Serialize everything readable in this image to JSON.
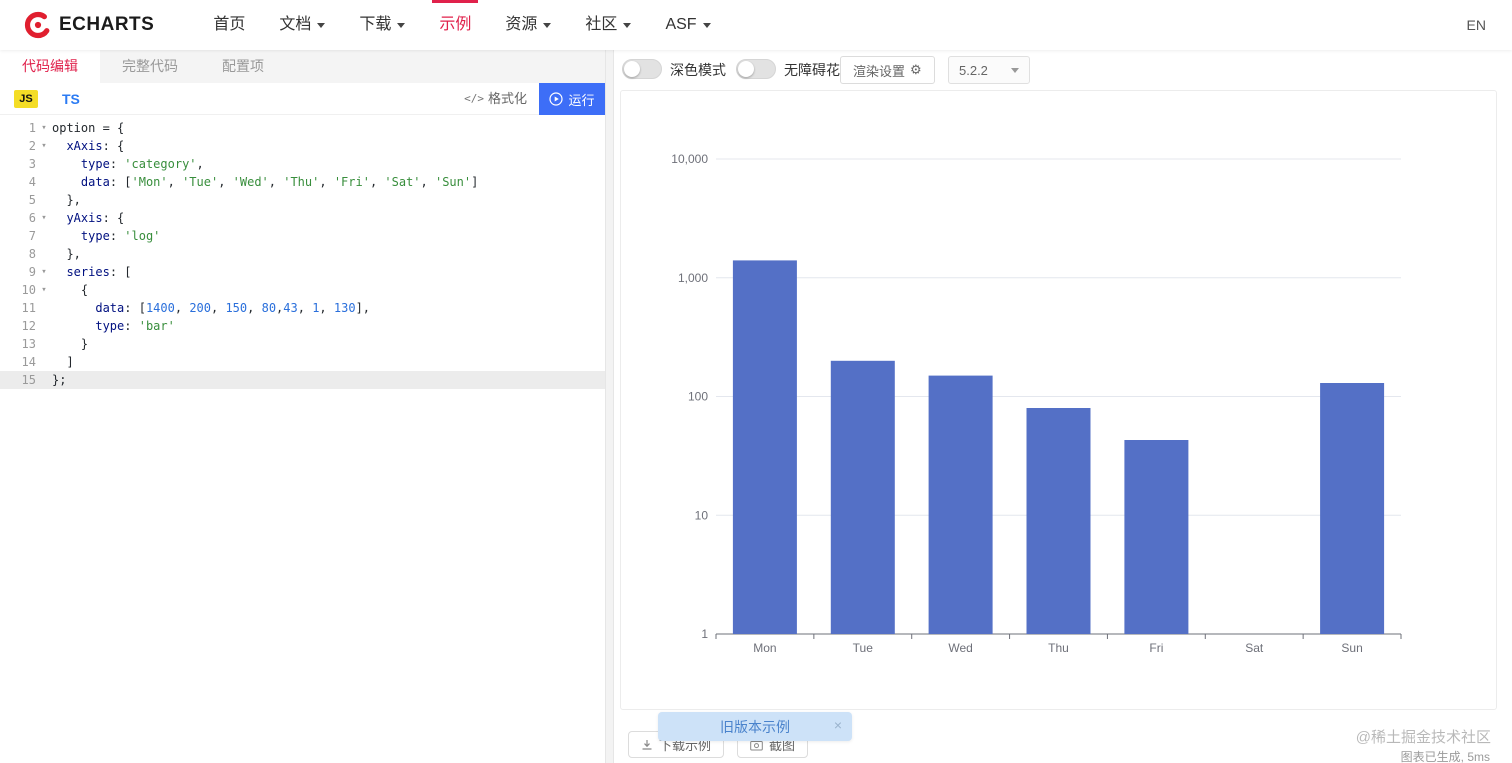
{
  "colors": {
    "accent": "#e0214b",
    "logo_red": "#e01f2f",
    "run_button": "#3d6ef7",
    "ts_blue": "#2b7bf3",
    "js_badge": "#f4dd26"
  },
  "nav": {
    "logo_text": "ECHARTS",
    "lang": "EN",
    "items": [
      {
        "label": "首页"
      },
      {
        "label": "文档"
      },
      {
        "label": "下载"
      },
      {
        "label": "示例"
      },
      {
        "label": "资源"
      },
      {
        "label": "社区"
      },
      {
        "label": "ASF"
      }
    ]
  },
  "editor": {
    "tabs": [
      {
        "label": "代码编辑"
      },
      {
        "label": "完整代码"
      },
      {
        "label": "配置项"
      }
    ],
    "js_label": "JS",
    "ts_label": "TS",
    "format_icon": "</>",
    "format_label": "格式化",
    "run_label": "运行",
    "lines": [
      {
        "num": 1,
        "fold": true,
        "cur": false,
        "segs": [
          [
            "p",
            "option = {"
          ]
        ]
      },
      {
        "num": 2,
        "fold": true,
        "cur": false,
        "segs": [
          [
            "p",
            "  "
          ],
          [
            "k",
            "xAxis"
          ],
          [
            "p",
            ": {"
          ]
        ]
      },
      {
        "num": 3,
        "fold": false,
        "cur": false,
        "segs": [
          [
            "p",
            "    "
          ],
          [
            "k",
            "type"
          ],
          [
            "p",
            ": "
          ],
          [
            "s",
            "'category'"
          ],
          [
            "p",
            ","
          ]
        ]
      },
      {
        "num": 4,
        "fold": false,
        "cur": false,
        "segs": [
          [
            "p",
            "    "
          ],
          [
            "k",
            "data"
          ],
          [
            "p",
            ": ["
          ],
          [
            "s",
            "'Mon'"
          ],
          [
            "p",
            ", "
          ],
          [
            "s",
            "'Tue'"
          ],
          [
            "p",
            ", "
          ],
          [
            "s",
            "'Wed'"
          ],
          [
            "p",
            ", "
          ],
          [
            "s",
            "'Thu'"
          ],
          [
            "p",
            ", "
          ],
          [
            "s",
            "'Fri'"
          ],
          [
            "p",
            ", "
          ],
          [
            "s",
            "'Sat'"
          ],
          [
            "p",
            ", "
          ],
          [
            "s",
            "'Sun'"
          ],
          [
            "p",
            "]"
          ]
        ]
      },
      {
        "num": 5,
        "fold": false,
        "cur": false,
        "segs": [
          [
            "p",
            "  },"
          ]
        ]
      },
      {
        "num": 6,
        "fold": true,
        "cur": false,
        "segs": [
          [
            "p",
            "  "
          ],
          [
            "k",
            "yAxis"
          ],
          [
            "p",
            ": {"
          ]
        ]
      },
      {
        "num": 7,
        "fold": false,
        "cur": false,
        "segs": [
          [
            "p",
            "    "
          ],
          [
            "k",
            "type"
          ],
          [
            "p",
            ": "
          ],
          [
            "s",
            "'log'"
          ]
        ]
      },
      {
        "num": 8,
        "fold": false,
        "cur": false,
        "segs": [
          [
            "p",
            "  },"
          ]
        ]
      },
      {
        "num": 9,
        "fold": true,
        "cur": false,
        "segs": [
          [
            "p",
            "  "
          ],
          [
            "k",
            "series"
          ],
          [
            "p",
            ": ["
          ]
        ]
      },
      {
        "num": 10,
        "fold": true,
        "cur": false,
        "segs": [
          [
            "p",
            "    {"
          ]
        ]
      },
      {
        "num": 11,
        "fold": false,
        "cur": false,
        "segs": [
          [
            "p",
            "      "
          ],
          [
            "k",
            "data"
          ],
          [
            "p",
            ": ["
          ],
          [
            "n",
            "1400"
          ],
          [
            "p",
            ", "
          ],
          [
            "n",
            "200"
          ],
          [
            "p",
            ", "
          ],
          [
            "n",
            "150"
          ],
          [
            "p",
            ", "
          ],
          [
            "n",
            "80"
          ],
          [
            "p",
            ","
          ],
          [
            "n",
            "43"
          ],
          [
            "p",
            ", "
          ],
          [
            "n",
            "1"
          ],
          [
            "p",
            ", "
          ],
          [
            "n",
            "130"
          ],
          [
            "p",
            "],"
          ]
        ]
      },
      {
        "num": 12,
        "fold": false,
        "cur": false,
        "segs": [
          [
            "p",
            "      "
          ],
          [
            "k",
            "type"
          ],
          [
            "p",
            ": "
          ],
          [
            "s",
            "'bar'"
          ]
        ]
      },
      {
        "num": 13,
        "fold": false,
        "cur": false,
        "segs": [
          [
            "p",
            "    }"
          ]
        ]
      },
      {
        "num": 14,
        "fold": false,
        "cur": false,
        "segs": [
          [
            "p",
            "  ]"
          ]
        ]
      },
      {
        "num": 15,
        "fold": false,
        "cur": true,
        "segs": [
          [
            "p",
            "};"
          ]
        ]
      }
    ]
  },
  "toolbar": {
    "dark_mode_label": "深色模式",
    "aria_pattern_label": "无障碍花纹",
    "render_settings_label": "渲染设置",
    "gear_icon": "⚙",
    "version": "5.2.2"
  },
  "chart_data": {
    "type": "bar",
    "categories": [
      "Mon",
      "Tue",
      "Wed",
      "Thu",
      "Fri",
      "Sat",
      "Sun"
    ],
    "values": [
      1400,
      200,
      150,
      80,
      43,
      1,
      130
    ],
    "yscale": "log",
    "ylim": [
      1,
      10000
    ],
    "yticks": [
      {
        "value": 10000,
        "label": "10,000"
      },
      {
        "value": 1000,
        "label": "1,000"
      },
      {
        "value": 100,
        "label": "100"
      },
      {
        "value": 10,
        "label": "10"
      },
      {
        "value": 1,
        "label": "1"
      }
    ],
    "color": "#5470c6",
    "grid": true,
    "legend": false,
    "xlabel": "",
    "ylabel": ""
  },
  "footer": {
    "download_label": "下载示例",
    "screenshot_label": "截图",
    "old_version_tip": "旧版本示例",
    "tip_close": "×",
    "status": "图表已生成, 5ms",
    "watermark": "@稀土掘金技术社区"
  }
}
